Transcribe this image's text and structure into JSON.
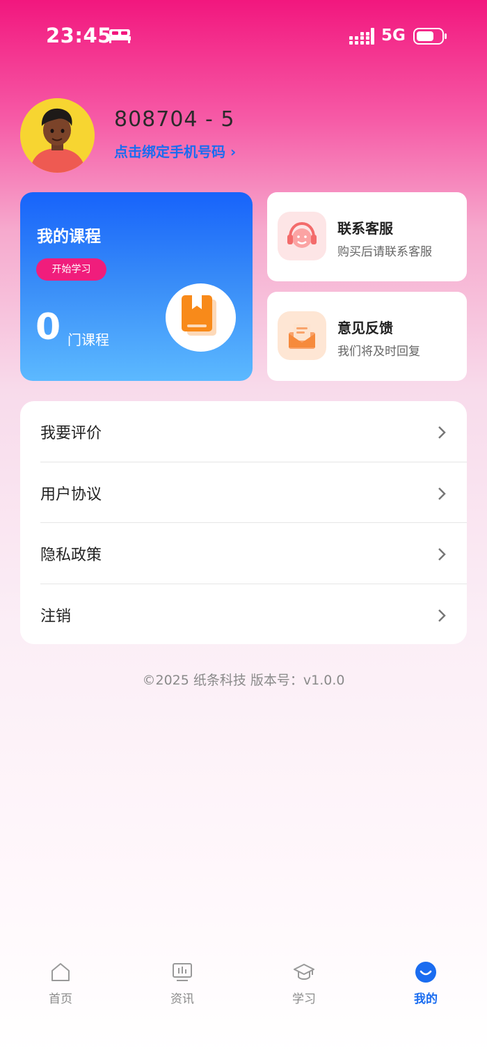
{
  "status_bar": {
    "time": "23:45",
    "network": "5G",
    "icons": [
      "bed-icon",
      "signal-icon",
      "battery-icon"
    ]
  },
  "profile": {
    "user_id": "808704 - 5",
    "bind_phone": "点击绑定手机号码 ›"
  },
  "course_card": {
    "title": "我的课程",
    "start_button": "开始学习",
    "count": "0",
    "unit": "门课程",
    "icon": "book-icon"
  },
  "service_card": {
    "title": "联系客服",
    "subtitle": "购买后请联系客服",
    "icon": "headset-icon"
  },
  "feedback_card": {
    "title": "意见反馈",
    "subtitle": "我们将及时回复",
    "icon": "mail-icon"
  },
  "menu": [
    {
      "label": "我要评价"
    },
    {
      "label": "用户协议"
    },
    {
      "label": "隐私政策"
    },
    {
      "label": "注销"
    }
  ],
  "copyright": "©2025 纸条科技 版本号：v1.0.0",
  "tabs": [
    {
      "label": "首页",
      "icon": "home-icon"
    },
    {
      "label": "资讯",
      "icon": "news-icon"
    },
    {
      "label": "学习",
      "icon": "graduation-cap-icon"
    },
    {
      "label": "我的",
      "icon": "profile-smile-icon",
      "active": true
    }
  ],
  "colors": {
    "accent_blue": "#1a6cf0",
    "accent_pink": "#f01d7c",
    "header_pink": "#f2177e"
  }
}
